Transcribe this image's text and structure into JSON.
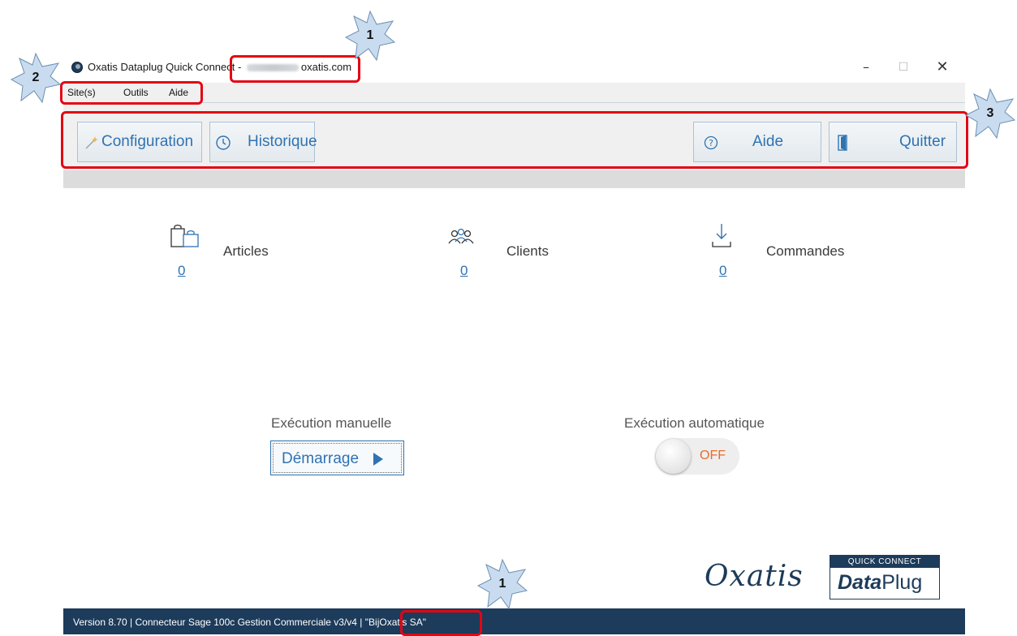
{
  "window": {
    "title_prefix": "Oxatis Dataplug Quick Connect - ",
    "title_suffix": "oxatis.com",
    "min_glyph": "–",
    "max_glyph": "☐",
    "close_glyph": "✕"
  },
  "menu": {
    "items": [
      {
        "label": "Site(s)"
      },
      {
        "label": "Outils"
      },
      {
        "label": "Aide"
      }
    ]
  },
  "toolbar": {
    "configuration_label": "Configuration",
    "historique_label": "Historique",
    "aide_label": "Aide",
    "quitter_label": "Quitter"
  },
  "stats": {
    "articles": {
      "label": "Articles",
      "count": "0",
      "icon": "shopping-bags-icon"
    },
    "clients": {
      "label": "Clients",
      "count": "0",
      "icon": "users-icon"
    },
    "commandes": {
      "label": "Commandes",
      "count": "0",
      "icon": "download-tray-icon"
    }
  },
  "execution": {
    "manual_title": "Exécution manuelle",
    "start_label": "Démarrage",
    "auto_title": "Exécution automatique",
    "auto_state": "OFF"
  },
  "logo": {
    "wordmark": "Oxatis",
    "badge_top": "QUICK CONNECT",
    "badge_bold": "Data",
    "badge_rest": "Plug"
  },
  "status_bar": {
    "text": "Version 8.70 | Connecteur Sage 100c Gestion Commerciale v3/v4 | \"BijOxatis SA\""
  },
  "annotations": {
    "markers": [
      "1",
      "2",
      "3",
      "1"
    ],
    "highlight_color": "#e30613"
  },
  "colors": {
    "accent_blue": "#2f73b2",
    "brand_navy": "#1d3b5a",
    "toggle_off": "#e86a2c"
  }
}
